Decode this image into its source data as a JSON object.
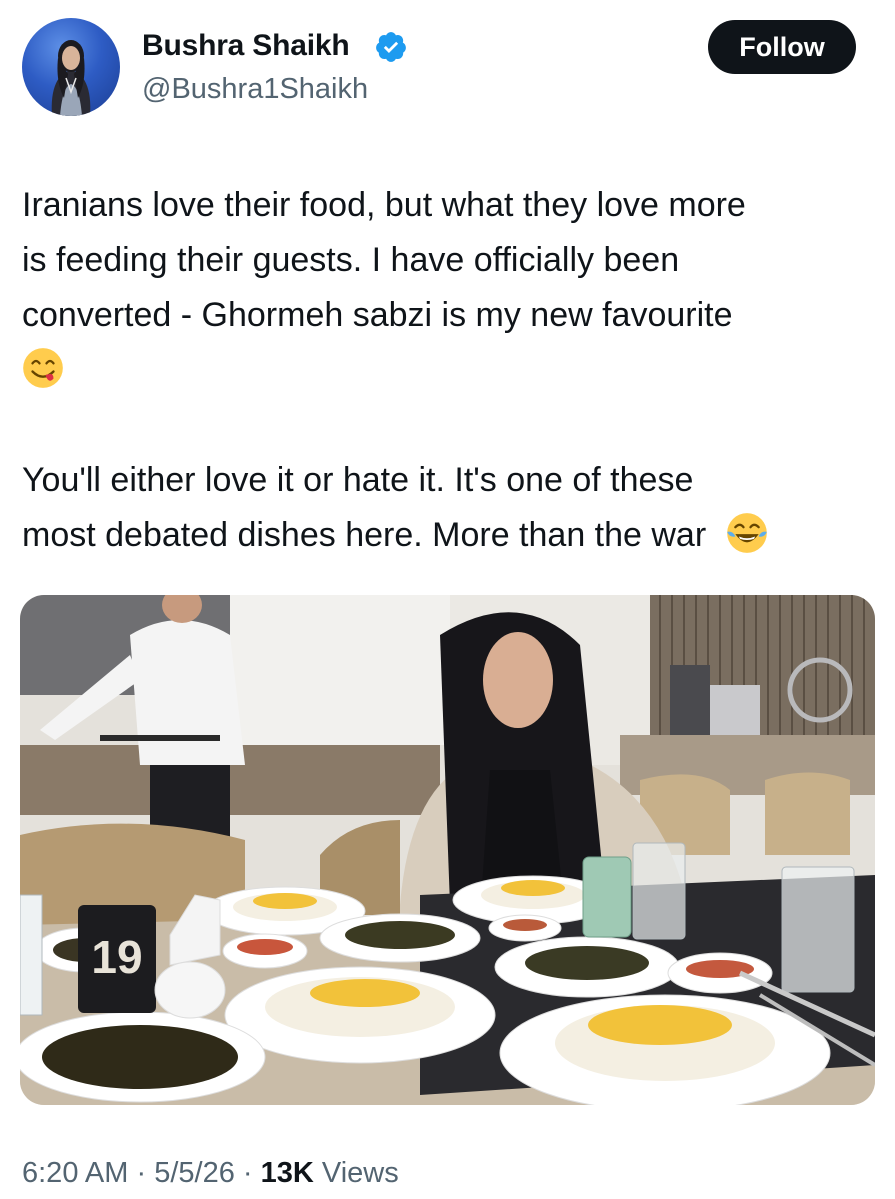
{
  "author": {
    "name": "Bushra Shaikh",
    "handle": "@Bushra1Shaikh",
    "verified": true,
    "avatar_icon": "profile-photo",
    "verified_icon": "verified-badge-icon",
    "badge_color": "#1d9bf0"
  },
  "follow_button": {
    "label": "Follow"
  },
  "tweet": {
    "paragraph_1_lines": [
      "Iranians love their food, but what they love more",
      "is feeding their guests. I have officially been",
      "converted - Ghormeh sabzi is my new favourite"
    ],
    "paragraph_1_emoji": "face-savoring-food-emoji",
    "paragraph_2_lines": [
      "You'll either love it or hate it. It's one of these",
      "most debated dishes here. More than the war"
    ],
    "paragraph_2_emoji": "face-with-tears-of-joy-emoji"
  },
  "media": {
    "photo_icon": "restaurant-photo",
    "table_number": "19"
  },
  "meta": {
    "time": "6:20 AM",
    "separator": "·",
    "date": "5/5/26",
    "views_count": "13K",
    "views_label": "Views"
  },
  "colors": {
    "text": "#0f1419",
    "secondary_text": "#536471",
    "button_bg": "#0f1419",
    "button_text": "#ffffff"
  }
}
